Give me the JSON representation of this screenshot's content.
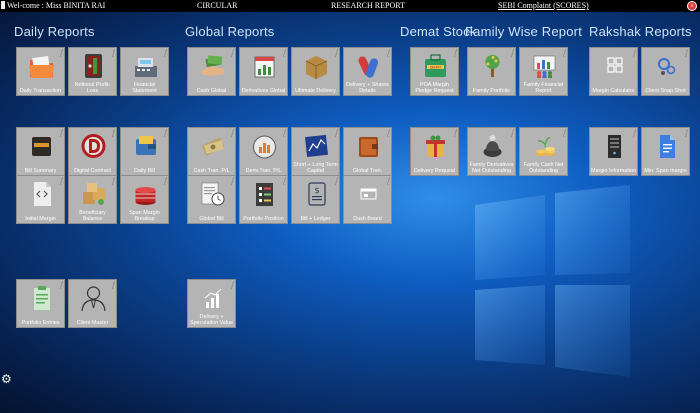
{
  "topbar": {
    "welcome": "Wel-come : Miss BINITA RAI",
    "circular": "CIRCULAR",
    "research": "RESEARCH REPORT",
    "sebi": "SEBI Complaint (SCORES)",
    "close": "×"
  },
  "sections": {
    "daily": "Daily Reports",
    "global": "Global Reports",
    "demat": "Demat Stock",
    "family": "Family Wise Report",
    "rakshak": "Rakshak Reports"
  },
  "tiles": {
    "daily_transaction": "Daily Transaction",
    "notional_profit_loss": "Notional Profit-Loss",
    "financial_statement": "Financial Statement",
    "bill_summary": "Bill Summary",
    "digital_contract": "Digital Contract",
    "daily_bill": "Daily Bill",
    "initial_margin": "Initial Margin",
    "beneficiary_balance": "Beneficiary Balance",
    "span_margin_breakup": "Span Margin Breakup",
    "portfolio_entries": "Portfolio Entries",
    "client_master": "Client Master",
    "cash_global": "Cash Global",
    "derivatives_global": "Derivatives Global",
    "ultimate_delivery": "Ultimate Delivery",
    "delivery_shares_details": "Delivery + Shares Details",
    "cash_tran_pl": "Cash Tran. P/L",
    "deriv_tran_pl": "Deriv.Tran. P/L",
    "short_long_term_capital": "Short + Long Term Capital",
    "global_tran": "Global Tran.",
    "global_bill": "Global Bill",
    "portfolio_position": "Portfolio Position",
    "bill_ledger": "Bill + Ledger",
    "dash_board": "Dash Board",
    "delivery_speculation_value": "Delivery + Speculation Value",
    "poa_margin_pledge_request": "POA Margin Pledge Request",
    "delivery_request": "Delivery Request",
    "family_portfolio": "Family Portfolio",
    "family_financial_report": "Family Financial Report",
    "family_derivatives_net_outstanding": "Family Derivatives Net Outstanding",
    "family_cash_net_outstanding": "Family Cash Net Outstanding",
    "margin_calculator": "Margin Calculator",
    "client_snap_shot": "Client Snap Shot",
    "margin_information": "Margin Information",
    "min_span_margin": "Min. Span margin"
  },
  "icons": {
    "demat_badge": "DEMAT",
    "gear": "⚙"
  },
  "colors": {
    "tile_bg": "#b4b4b4",
    "topbar_bg": "#000000",
    "close_red": "#e23b3b"
  }
}
